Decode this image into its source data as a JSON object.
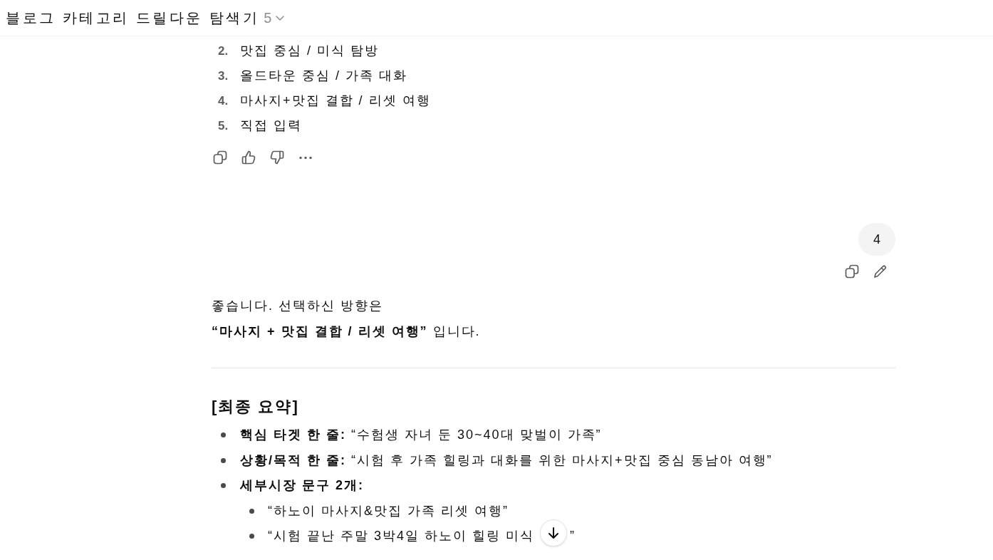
{
  "header": {
    "title": "블로그 카테고리 드릴다운 탐색기",
    "version": "5"
  },
  "options_list": {
    "items": [
      {
        "number": "2.",
        "text": "맛집 중심 / 미식 탐방"
      },
      {
        "number": "3.",
        "text": "올드타운 중심 / 가족 대화"
      },
      {
        "number": "4.",
        "text": "마사지+맛집 결합 / 리셋 여행"
      },
      {
        "number": "5.",
        "text": "직접 입력"
      }
    ]
  },
  "user_message": {
    "text": "4"
  },
  "reply": {
    "lines": [
      "좋습니다. 선택하신 방향은",
      "**“마사지 + 맛집 결합 / 리셋 여행”** 입니다."
    ],
    "heading": "[최종 요약]",
    "bullets": [
      {
        "label": "핵심 타겟 한 줄:",
        "text": "“수험생 자녀 둔 30~40대 맞벌이 가족”"
      },
      {
        "label": "상황/목적 한 줄:",
        "text": "“시험 후 가족 힐링과 대화를 위한 마사지+맛집 중심 동남아 여행”"
      },
      {
        "label": "세부시장 문구 2개:",
        "children": [
          {
            "text": "“하노이 마사지&맛집 가족 리셋 여행”"
          },
          {
            "text": "“시험 끝난 주말 3박4일 하노이 힐링 미식",
            "text_after_cover": "”"
          }
        ]
      }
    ]
  }
}
